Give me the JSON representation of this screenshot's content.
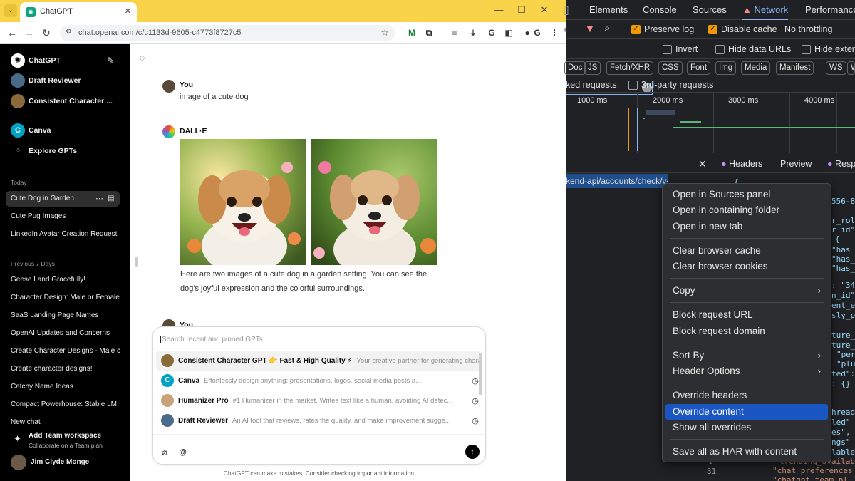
{
  "browser": {
    "tab_title": "ChatGPT",
    "url": "chat.openai.com/c/c1133d-9605-c4773f8727c5"
  },
  "sidebar": {
    "header": "ChatGPT",
    "gpts": [
      {
        "label": "Draft Reviewer"
      },
      {
        "label": "Consistent Character ..."
      },
      {
        "label": "Canva"
      },
      {
        "label": "Explore GPTs"
      }
    ],
    "today_label": "Today",
    "today": [
      "Cute Dog in Garden",
      "Cute Pug Images",
      "LinkedIn Avatar Creation Request"
    ],
    "prev_label": "Previous 7 Days",
    "previous": [
      "Geese Land Gracefully!",
      "Character Design: Male or Female",
      "SaaS Landing Page Names",
      "OpenAI Updates and Concerns",
      "Create Character Designs - Male c",
      "Create character designs!",
      "Catchy Name Ideas",
      "Compact Powerhouse: Stable LM",
      "New chat"
    ],
    "team_title": "Add Team workspace",
    "team_sub": "Collaborate on a Team plan",
    "user_name": "Jim Clyde Monge"
  },
  "chat": {
    "user_label": "You",
    "user_message": "image of a cute dog",
    "bot_label": "DALL·E",
    "bot_message_1": "Here are two images of a cute dog in a garden setting. You can see the",
    "bot_message_2": "dog's joyful expression and the colorful surroundings.",
    "user_label_2": "You"
  },
  "composer": {
    "search_placeholder": "Search recent and pinned GPTs",
    "gpts": [
      {
        "name": "Consistent Character GPT 👉 Fast & High Quality ⚡",
        "desc": "Your creative partner for generating charac"
      },
      {
        "name": "Canva",
        "desc": "Effortlessly design anything: presentations, logos, social media posts a..."
      },
      {
        "name": "Humanizer Pro",
        "desc": "#1 Humanizer in the market. Writes text like a human, avoiding AI detec..."
      },
      {
        "name": "Draft Reviewer",
        "desc": "An AI tool that reviews, rates the quality, and make improvement sugge..."
      }
    ],
    "at_symbol": "@",
    "disclaimer": "ChatGPT can make mistakes. Consider checking important information."
  },
  "devtools": {
    "tabs": [
      "Elements",
      "Console",
      "Sources",
      "Network",
      "Performance"
    ],
    "active_tab": "Network",
    "preserve_log": "Preserve log",
    "disable_cache": "Disable cache",
    "throttling": "No throttling",
    "invert": "Invert",
    "hide_data_urls": "Hide data URLs",
    "hide_ext": "Hide exter",
    "filter_chips": [
      "Doc",
      "JS",
      "Fetch/XHR",
      "CSS",
      "Font",
      "Img",
      "Media",
      "Manifest",
      "WS",
      "W"
    ],
    "blocked_requests": "ked requests",
    "third_party": "3rd-party requests",
    "timeline_labels": [
      "1000 ms",
      "2000 ms",
      "3000 ms",
      "4000 ms"
    ],
    "detail_tabs": [
      "Headers",
      "Preview",
      "Resp"
    ],
    "selected_url": "kend-api/accounts/check/v4",
    "code_lines": [
      "{",
      "556-8",
      "r_rol",
      "r_id\"",
      "{",
      "\"has_",
      "\"has_",
      "\"has_",
      ": \"34",
      "n_id\"",
      "ent_e",
      "sly_p",
      "ture_",
      "ture_",
      "\"per",
      "\"plu",
      "ted\":",
      ": {}",
      "hread",
      "led\"",
      "es\",",
      "ngs\"",
      "lable",
      "\"chat_preferences",
      "\"chatgpt_team_pl"
    ],
    "gutter_lines": [
      "1",
      "31"
    ],
    "misc_line": "trending_availab"
  },
  "context_menu": {
    "groups": [
      [
        "Open in Sources panel",
        "Open in containing folder",
        "Open in new tab"
      ],
      [
        "Clear browser cache",
        "Clear browser cookies"
      ],
      [
        "Copy"
      ],
      [
        "Block request URL",
        "Block request domain"
      ],
      [
        "Sort By",
        "Header Options"
      ],
      [
        "Override headers",
        "Override content",
        "Show all overrides"
      ],
      [
        "Save all as HAR with content"
      ]
    ],
    "highlighted": "Override content"
  },
  "colors": {
    "tabstrip": "#f9d44a",
    "devtools_bg": "#202124",
    "accent": "#8ab4f8",
    "checkbox": "#f29900",
    "menu_highlight": "#1a56c2"
  }
}
